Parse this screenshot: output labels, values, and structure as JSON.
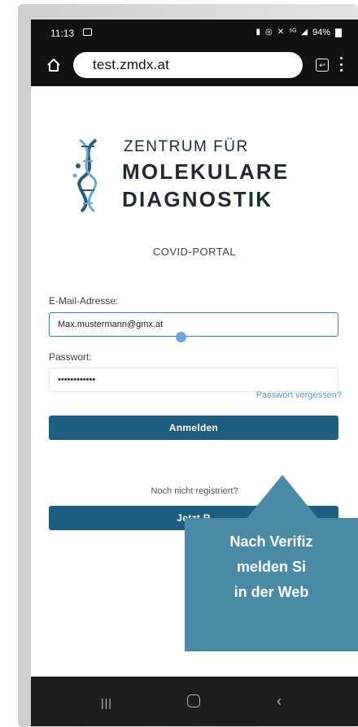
{
  "status_bar": {
    "time": "11:13",
    "battery": "94%",
    "signal": "⁵ᴳ"
  },
  "browser": {
    "url": "test.zmdx.at"
  },
  "logo": {
    "line1": "ZENTRUM FÜR",
    "line2": "MOLEKULARE",
    "line3": "DIAGNOSTIK"
  },
  "portal_title": "COVID-PORTAL",
  "form": {
    "email_label": "E-Mail-Adresse:",
    "email_value": "Max.mustermann@gmx.at",
    "password_label": "Passwort:",
    "password_value": "••••••••••••",
    "forgot_link": "Passwort vergessen?",
    "login_button": "Anmelden",
    "not_registered_text": "Noch nicht registriert?",
    "register_button": "Jetzt R"
  },
  "callout": {
    "line1": "Nach Verifiz",
    "line2": "melden Si",
    "line3": "in der Web"
  },
  "nav": {
    "recent": "|||",
    "back": "‹"
  },
  "colors": {
    "primary_button": "#1d5d80",
    "callout_bg": "#4a8aa6",
    "link": "#5b9dbd"
  }
}
